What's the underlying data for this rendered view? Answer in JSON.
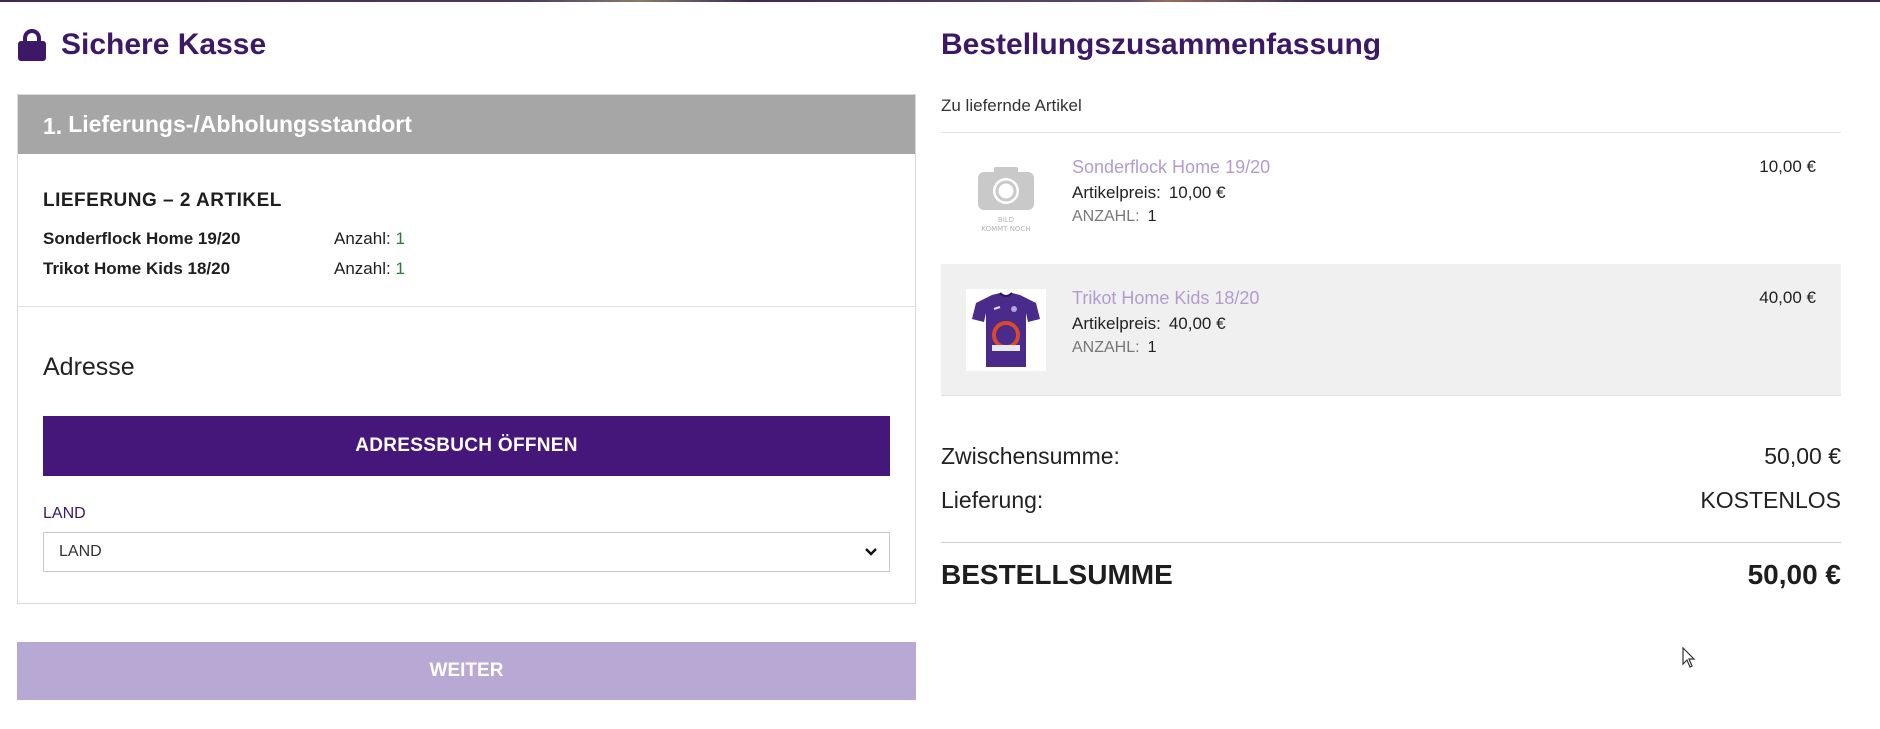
{
  "checkout": {
    "title": "Sichere Kasse",
    "step": {
      "number": "1.",
      "title": "Lieferungs-/Abholungsstandort"
    },
    "delivery": {
      "heading": "LIEFERUNG – 2 ARTIKEL",
      "items": [
        {
          "name": "Sonderflock Home 19/20",
          "qty_label": "Anzahl:",
          "qty": "1"
        },
        {
          "name": "Trikot Home Kids 18/20",
          "qty_label": "Anzahl:",
          "qty": "1"
        }
      ]
    },
    "address": {
      "title": "Adresse",
      "addressbook_button": "ADRESSBUCH ÖFFNEN",
      "country_label": "LAND",
      "country_selected": "LAND"
    },
    "next_button": "WEITER"
  },
  "summary": {
    "title": "Bestellungszusammenfassung",
    "items_label": "Zu liefernde Artikel",
    "items": [
      {
        "name": "Sonderflock Home 19/20",
        "unit_price_label": "Artikelpreis:",
        "unit_price": "10,00 €",
        "qty_label": "ANZAHL:",
        "qty": "1",
        "total": "10,00 €",
        "image_placeholder_line1": "BILD",
        "image_placeholder_line2": "KOMMT NOCH"
      },
      {
        "name": "Trikot Home Kids 18/20",
        "unit_price_label": "Artikelpreis:",
        "unit_price": "40,00 €",
        "qty_label": "ANZAHL:",
        "qty": "1",
        "total": "40,00 €"
      }
    ],
    "subtotal_label": "Zwischensumme:",
    "subtotal": "50,00 €",
    "shipping_label": "Lieferung:",
    "shipping": "KOSTENLOS",
    "total_label": "BESTELLSUMME",
    "total": "50,00 €"
  },
  "colors": {
    "brand_purple": "#46177a",
    "title_purple": "#3d1866",
    "disabled_button": "#b8a8d4",
    "product_link": "#b39bd0",
    "step_header_gray": "#a6a6a6"
  },
  "icons": {
    "title_icon": "lock-icon",
    "select_icon": "chevron-down-icon",
    "placeholder_icon": "camera-icon"
  }
}
